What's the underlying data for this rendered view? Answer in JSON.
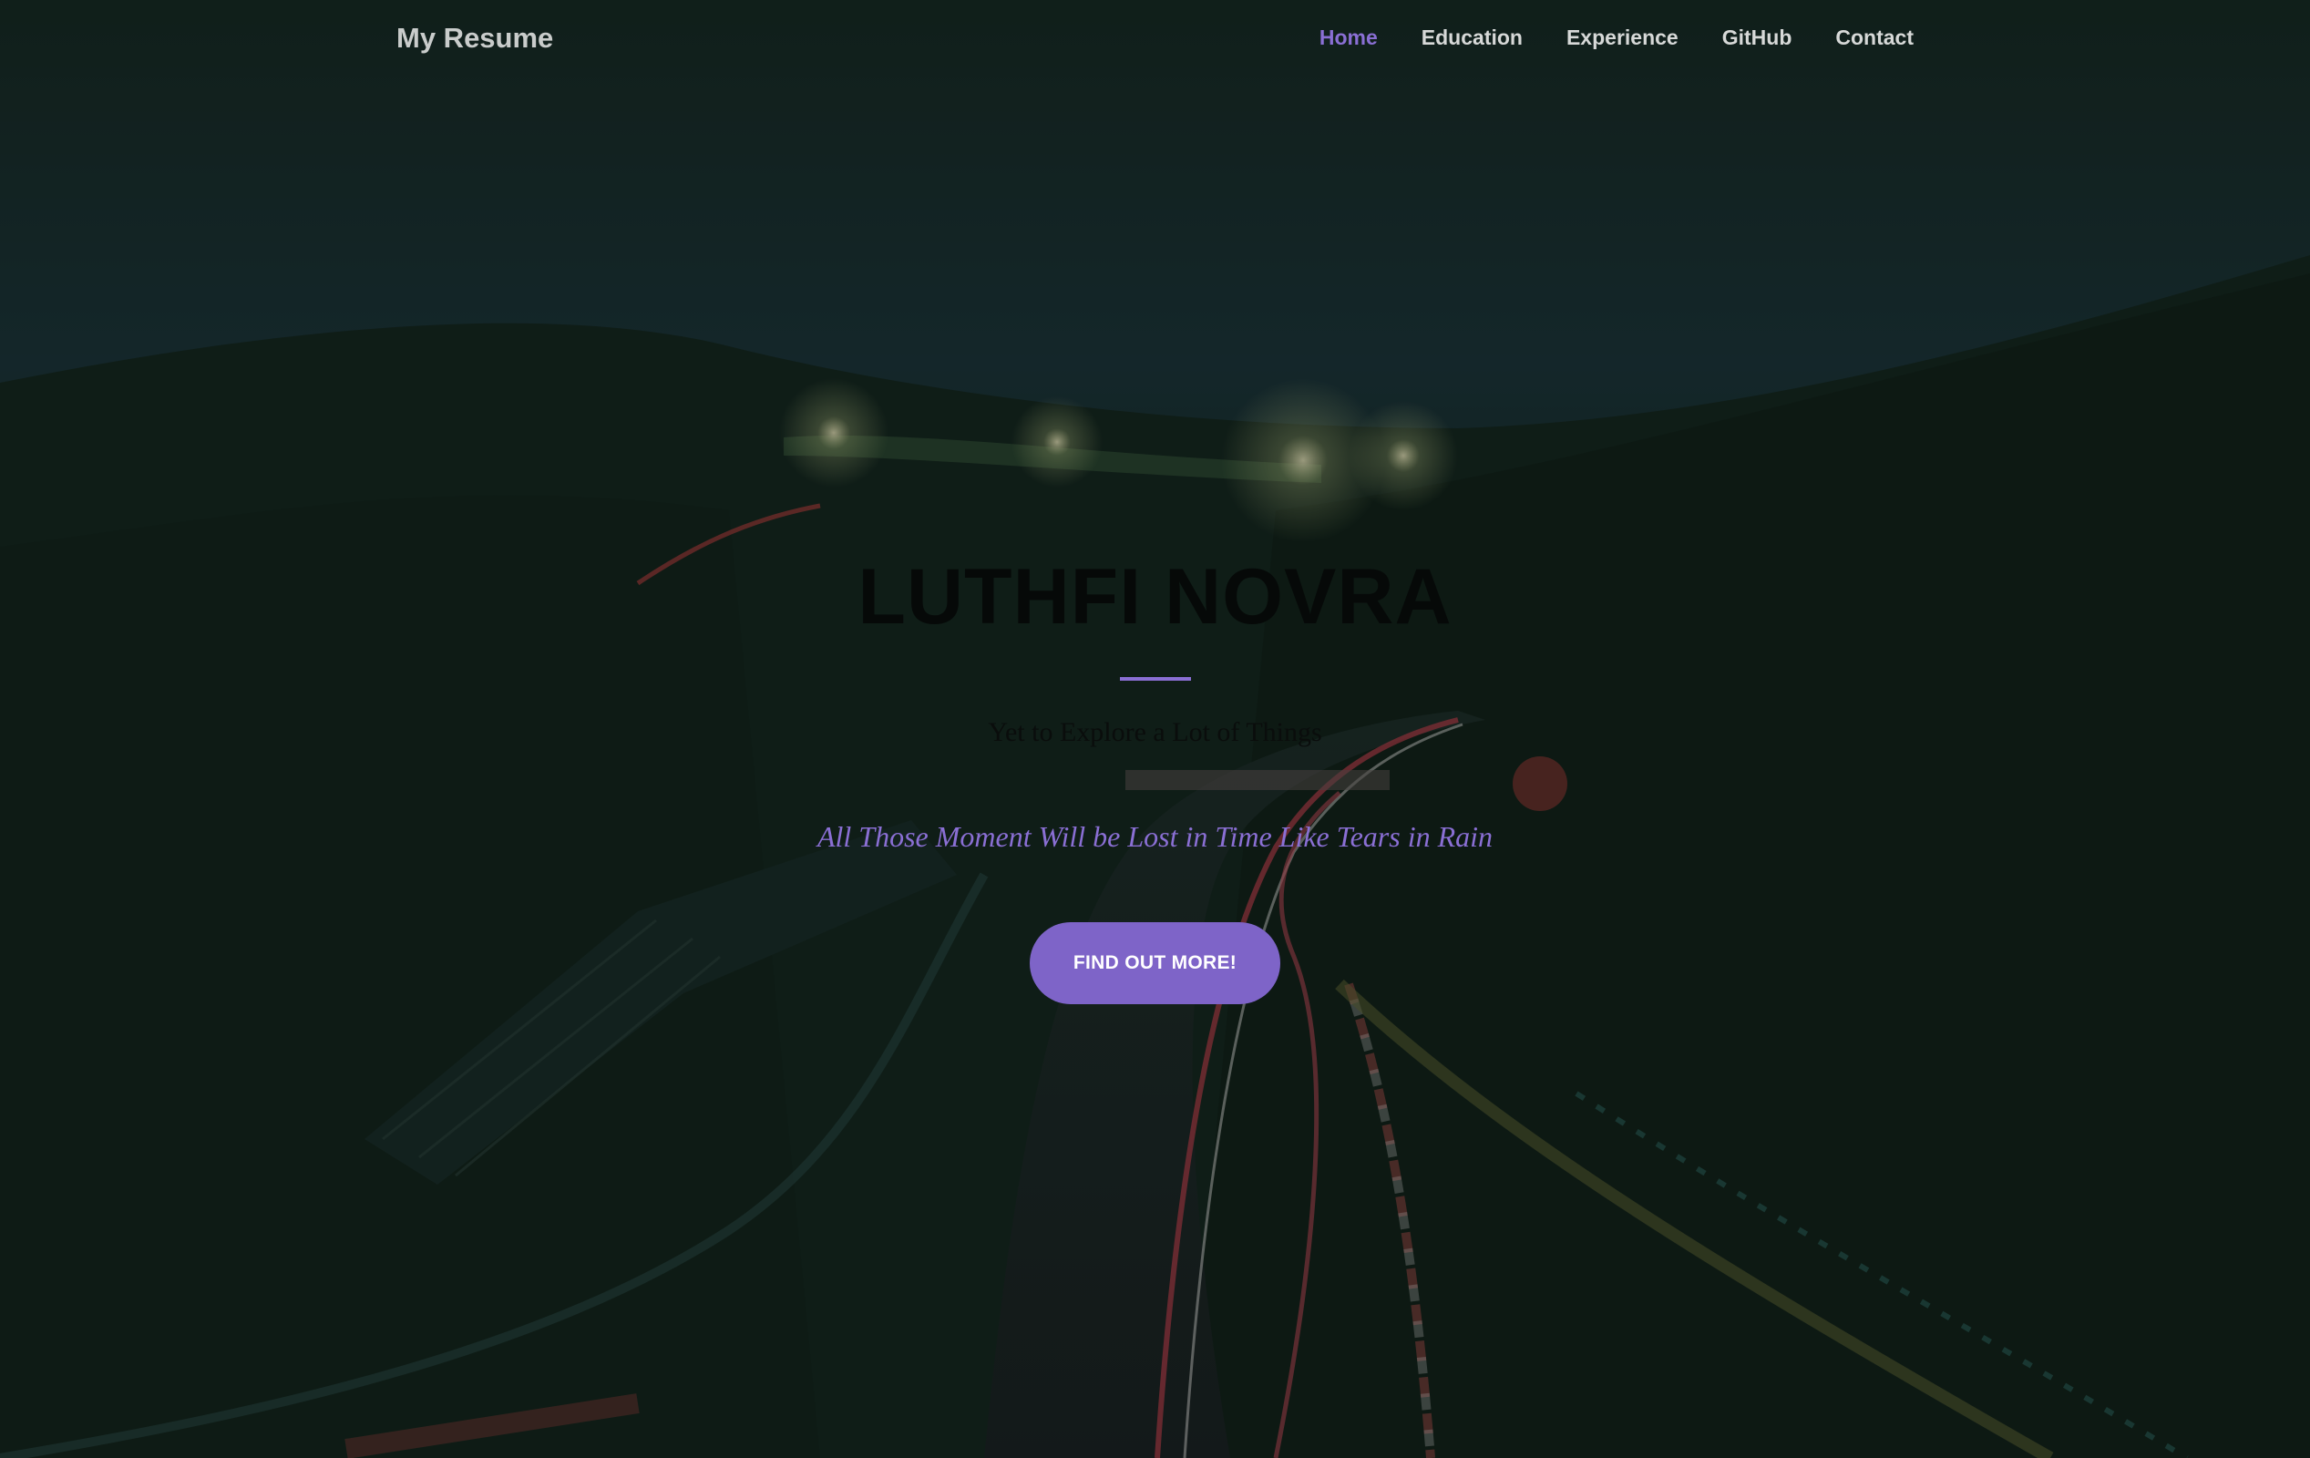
{
  "navbar": {
    "brand": "My Resume",
    "items": [
      {
        "label": "Home",
        "active": true
      },
      {
        "label": "Education",
        "active": false
      },
      {
        "label": "Experience",
        "active": false
      },
      {
        "label": "GitHub",
        "active": false
      },
      {
        "label": "Contact",
        "active": false
      }
    ]
  },
  "hero": {
    "title": "LUTHFI NOVRA",
    "subtitle": "Yet to Explore a Lot of Things",
    "quote": "All Those Moment Will be Lost in Time Like Tears in Rain",
    "cta_label": "Find Out More!"
  },
  "background": {
    "icon": "night-racetrack-image"
  },
  "colors": {
    "accent": "#8a6fd4",
    "button": "#7e64c8",
    "background": "#0f1b17"
  }
}
